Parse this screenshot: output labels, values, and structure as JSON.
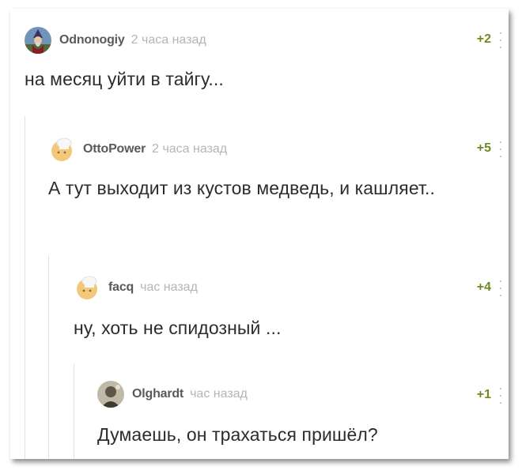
{
  "comments": [
    {
      "author": "Odnonogiy",
      "time": "2 часа назад",
      "score": "+2",
      "avatar_icon": "wizard-avatar-icon",
      "text": "на месяц уйти в тайгу..."
    },
    {
      "author": "OttoPower",
      "time": "2 часа назад",
      "score": "+5",
      "avatar_icon": "default-chef-avatar-icon",
      "text": "А тут выходит из кустов медведь, и кашляет.."
    },
    {
      "author": "facq",
      "time": "час назад",
      "score": "+4",
      "avatar_icon": "default-chef-avatar-icon",
      "text": "ну, хоть не спидозный ..."
    },
    {
      "author": "Olghardt",
      "time": "час назад",
      "score": "+1",
      "avatar_icon": "photo-avatar-icon",
      "text": "Думаешь, он трахаться пришёл?"
    }
  ],
  "colors": {
    "score_green": "#6f8b1f",
    "author_gray": "#5a5a5a",
    "time_gray": "#b5b5b5",
    "text_dark": "#2c2c2c"
  }
}
